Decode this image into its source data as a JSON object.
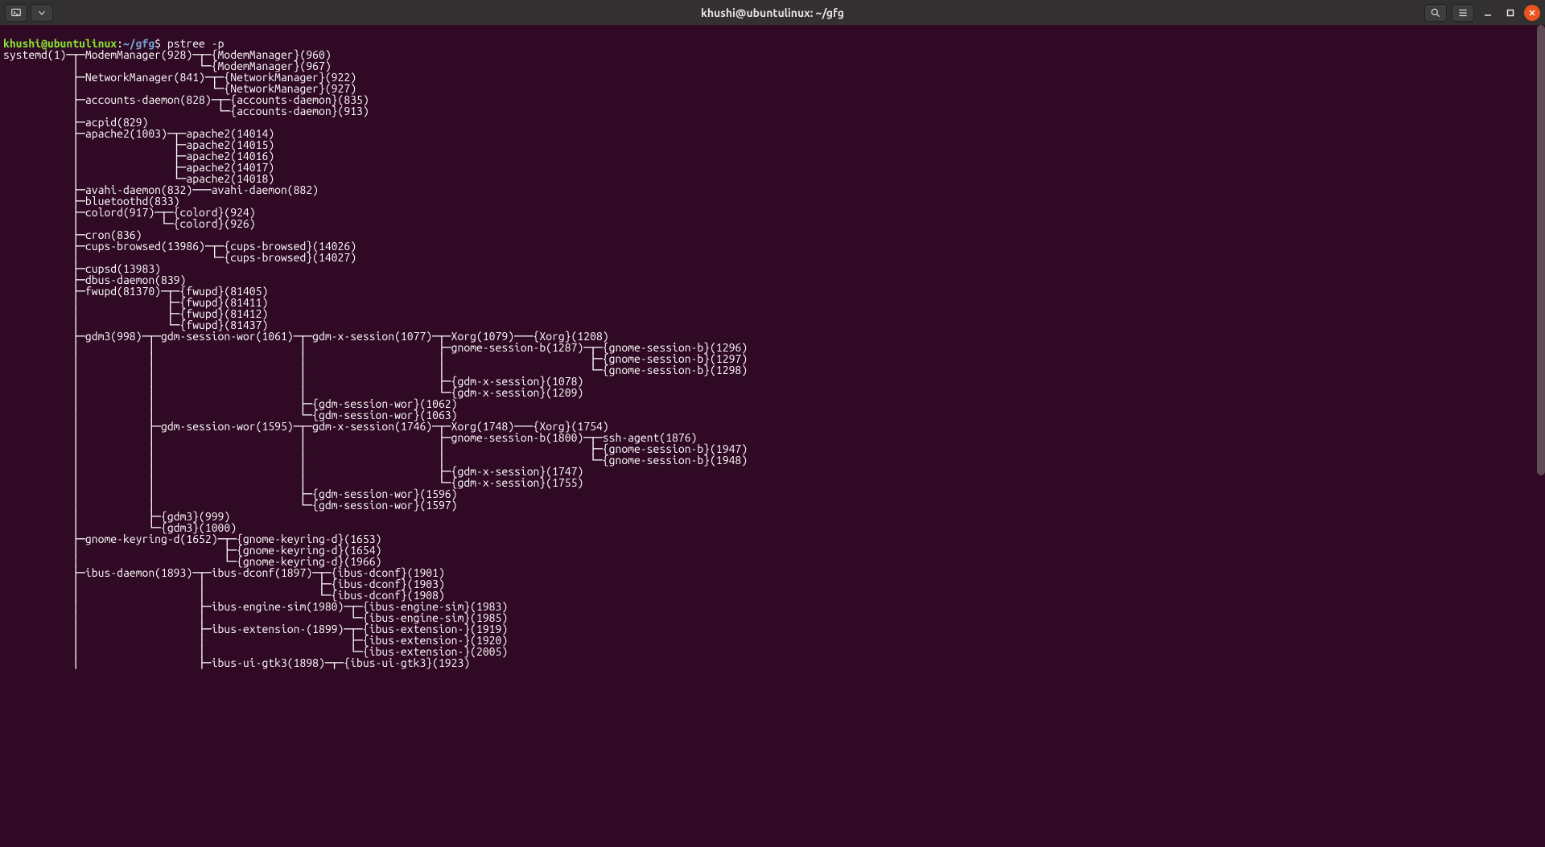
{
  "window": {
    "title": "khushi@ubuntulinux: ~/gfg"
  },
  "prompt": {
    "user_host": "khushi@ubuntulinux",
    "colon": ":",
    "path": "~/gfg",
    "dollar": "$",
    "command": "pstree -p"
  },
  "tree_lines": [
    "systemd(1)─┬─ModemManager(928)─┬─{ModemManager}(960)",
    "           │                   └─{ModemManager}(967)",
    "           ├─NetworkManager(841)─┬─{NetworkManager}(922)",
    "           │                     └─{NetworkManager}(927)",
    "           ├─accounts-daemon(828)─┬─{accounts-daemon}(835)",
    "           │                      └─{accounts-daemon}(913)",
    "           ├─acpid(829)",
    "           ├─apache2(1003)─┬─apache2(14014)",
    "           │               ├─apache2(14015)",
    "           │               ├─apache2(14016)",
    "           │               ├─apache2(14017)",
    "           │               └─apache2(14018)",
    "           ├─avahi-daemon(832)───avahi-daemon(882)",
    "           ├─bluetoothd(833)",
    "           ├─colord(917)─┬─{colord}(924)",
    "           │             └─{colord}(926)",
    "           ├─cron(836)",
    "           ├─cups-browsed(13986)─┬─{cups-browsed}(14026)",
    "           │                     └─{cups-browsed}(14027)",
    "           ├─cupsd(13983)",
    "           ├─dbus-daemon(839)",
    "           ├─fwupd(81370)─┬─{fwupd}(81405)",
    "           │              ├─{fwupd}(81411)",
    "           │              ├─{fwupd}(81412)",
    "           │              └─{fwupd}(81437)",
    "           ├─gdm3(998)─┬─gdm-session-wor(1061)─┬─gdm-x-session(1077)─┬─Xorg(1079)───{Xorg}(1208)",
    "           │           │                       │                     ├─gnome-session-b(1287)─┬─{gnome-session-b}(1296)",
    "           │           │                       │                     │                       ├─{gnome-session-b}(1297)",
    "           │           │                       │                     │                       └─{gnome-session-b}(1298)",
    "           │           │                       │                     ├─{gdm-x-session}(1078)",
    "           │           │                       │                     └─{gdm-x-session}(1209)",
    "           │           │                       ├─{gdm-session-wor}(1062)",
    "           │           │                       └─{gdm-session-wor}(1063)",
    "           │           ├─gdm-session-wor(1595)─┬─gdm-x-session(1746)─┬─Xorg(1748)───{Xorg}(1754)",
    "           │           │                       │                     ├─gnome-session-b(1800)─┬─ssh-agent(1876)",
    "           │           │                       │                     │                       ├─{gnome-session-b}(1947)",
    "           │           │                       │                     │                       └─{gnome-session-b}(1948)",
    "           │           │                       │                     ├─{gdm-x-session}(1747)",
    "           │           │                       │                     └─{gdm-x-session}(1755)",
    "           │           │                       ├─{gdm-session-wor}(1596)",
    "           │           │                       └─{gdm-session-wor}(1597)",
    "           │           ├─{gdm3}(999)",
    "           │           └─{gdm3}(1000)",
    "           ├─gnome-keyring-d(1652)─┬─{gnome-keyring-d}(1653)",
    "           │                       ├─{gnome-keyring-d}(1654)",
    "           │                       └─{gnome-keyring-d}(1966)",
    "           ├─ibus-daemon(1893)─┬─ibus-dconf(1897)─┬─{ibus-dconf}(1901)",
    "           │                   │                  ├─{ibus-dconf}(1903)",
    "           │                   │                  └─{ibus-dconf}(1908)",
    "           │                   ├─ibus-engine-sim(1980)─┬─{ibus-engine-sim}(1983)",
    "           │                   │                       └─{ibus-engine-sim}(1985)",
    "           │                   ├─ibus-extension-(1899)─┬─{ibus-extension-}(1919)",
    "           │                   │                       ├─{ibus-extension-}(1920)",
    "           │                   │                       └─{ibus-extension-}(2005)",
    "           │                   ├─ibus-ui-gtk3(1898)─┬─{ibus-ui-gtk3}(1923)"
  ]
}
